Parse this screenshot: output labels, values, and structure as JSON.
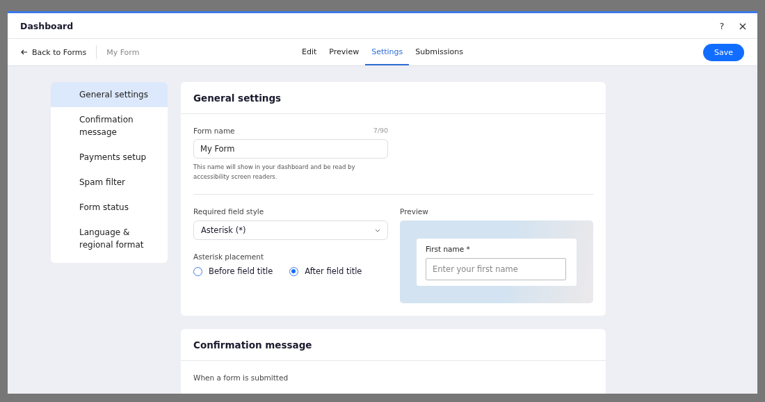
{
  "window": {
    "title": "Dashboard",
    "help": "?",
    "close": "×"
  },
  "toolbar": {
    "back": "Back to Forms",
    "form_name": "My Form",
    "save": "Save"
  },
  "tabs": [
    {
      "label": "Edit",
      "selected": false
    },
    {
      "label": "Preview",
      "selected": false
    },
    {
      "label": "Settings",
      "selected": true
    },
    {
      "label": "Submissions",
      "selected": false
    }
  ],
  "sidebar": {
    "items": [
      {
        "label": "General settings",
        "selected": true
      },
      {
        "label": "Confirmation message",
        "selected": false
      },
      {
        "label": "Payments setup",
        "selected": false
      },
      {
        "label": "Spam filter",
        "selected": false
      },
      {
        "label": "Form status",
        "selected": false
      },
      {
        "label": "Language & regional format",
        "selected": false
      }
    ]
  },
  "general_settings": {
    "title": "General settings",
    "form_name_label": "Form name",
    "counter": "7/90",
    "form_name_value": "My Form",
    "hint": "This name will show in your dashboard and be read by accessibility screen readers.",
    "required_label": "Required field style",
    "required_value": "Asterisk (*)",
    "placement_label": "Asterisk placement",
    "placement_options": [
      {
        "label": "Before field title",
        "selected": false
      },
      {
        "label": "After field title",
        "selected": true
      }
    ],
    "preview": {
      "label": "Preview",
      "field_label": "First name *",
      "placeholder": "Enter your first name"
    }
  },
  "confirmation": {
    "title": "Confirmation message",
    "subtitle": "When a form is submitted"
  }
}
